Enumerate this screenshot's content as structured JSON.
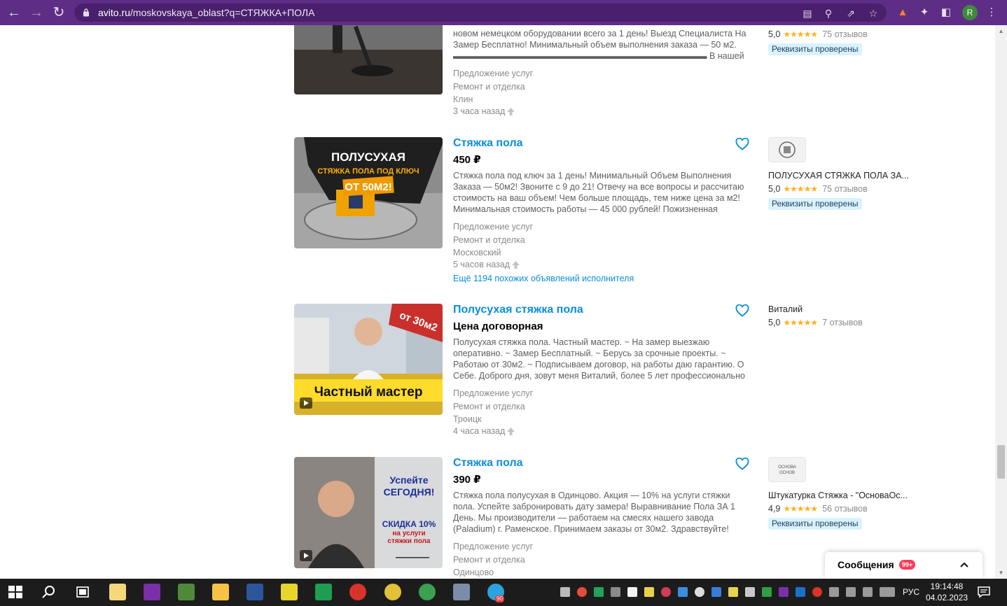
{
  "browser": {
    "url_host": "avito.ru",
    "url_path": "/moskovskaya_oblast?q=СТЯЖКА+ПОЛА",
    "profile_initial": "R"
  },
  "top_partial": {
    "desc": "новом немецком оборудовании всего за 1 день! Выезд Специалиста На Замер Бесплатно! Минимальный объем выполнения заказа — 50 м2. ▬▬▬▬▬▬▬▬▬▬▬▬▬▬▬▬▬▬▬▬▬▬▬▬▬▬▬▬▬ В нашей команде",
    "category": "Предложение услуг",
    "subcategory": "Ремонт и отделка",
    "location": "Клин",
    "time": "3 часа назад",
    "seller_rating": "5,0",
    "seller_reviews": "75 отзывов",
    "verified": "Реквизиты проверены"
  },
  "listings": [
    {
      "title": "Стяжка пола",
      "price": "450 ₽",
      "desc": "Стяжка пола под ключ за 1 день! Минимальный Объем Выполнения Заказа — 50м2! Звоните с 9 до 21! Отвечу на все вопросы и рассчитаю стоимость на ваш объем! Чем больше площадь, тем ниже цена за м2! Минимальная стоимость работы — 45 000 рублей! Пожизненная",
      "category": "Предложение услуг",
      "subcategory": "Ремонт и отделка",
      "location": "Московский",
      "time": "5 часов назад",
      "more_link": "Ещё 1194 похожих объявлений исполнителя",
      "thumb_text": [
        "ПОЛУСУХАЯ",
        "СТЯЖКА ПОЛА ПОД КЛЮЧ",
        "ОТ 50М2!"
      ],
      "seller_name": "ПОЛУСУХАЯ СТЯЖКА ПОЛА ЗА...",
      "seller_rating": "5,0",
      "seller_reviews": "75 отзывов",
      "verified": "Реквизиты проверены"
    },
    {
      "title": "Полусухая стяжка пола",
      "price": "Цена договорная",
      "desc": "Полусухая стяжка пола. Частный мастер. ~ На замер выезжаю оперативно. ~ Замер Бесплатный. ~ Берусь за срочные проекты. ~ Работаю от 30м2. ~ Подписываем договор, на работы даю гарантию. О Себе. Доброго дня, зовут меня Виталий, более 5 лет профессионально",
      "category": "Предложение услуг",
      "subcategory": "Ремонт и отделка",
      "location": "Троицк",
      "time": "4 часа назад",
      "thumb_text": [
        "от 30м2",
        "Частный мастер"
      ],
      "seller_name": "Виталий",
      "seller_rating": "5,0",
      "seller_reviews": "7 отзывов"
    },
    {
      "title": "Стяжка пола",
      "price": "390 ₽",
      "desc": "Стяжка пола полусухая в Одинцово. Акция — 10% на услуги стяжки пола. Успейте забронировать дату замера! Выравнивание Пола ЗА 1 День. Мы производители — работаем на смесях нашего завода (Paladium) г. Раменское. Принимаем заказы от 30м2. Здравствуйте!",
      "category": "Предложение услуг",
      "subcategory": "Ремонт и отделка",
      "location": "Одинцово",
      "thumb_text": [
        "Успейте",
        "СЕГОДНЯ!",
        "СКИДКА 10%",
        "на услуги",
        "стяжки пола"
      ],
      "seller_logo_text": [
        "ОСНОВА",
        "ОСНОВ"
      ],
      "seller_name": "Штукатурка Стяжка - \"ОсноваОс...",
      "seller_rating": "4,9",
      "seller_reviews": "56 отзывов",
      "verified": "Реквизиты проверены"
    }
  ],
  "stars": "★★★★★",
  "messages": {
    "label": "Сообщения",
    "badge": "99+"
  },
  "taskbar": {
    "lang": "РУС",
    "time": "19:14:48",
    "date": "04.02.2023",
    "telegram_badge": "90"
  },
  "colors": {
    "chrome": "#5e2e86",
    "link": "#0a8ddc",
    "verified_bg": "#d9f2ff",
    "star": "#ffb021"
  }
}
